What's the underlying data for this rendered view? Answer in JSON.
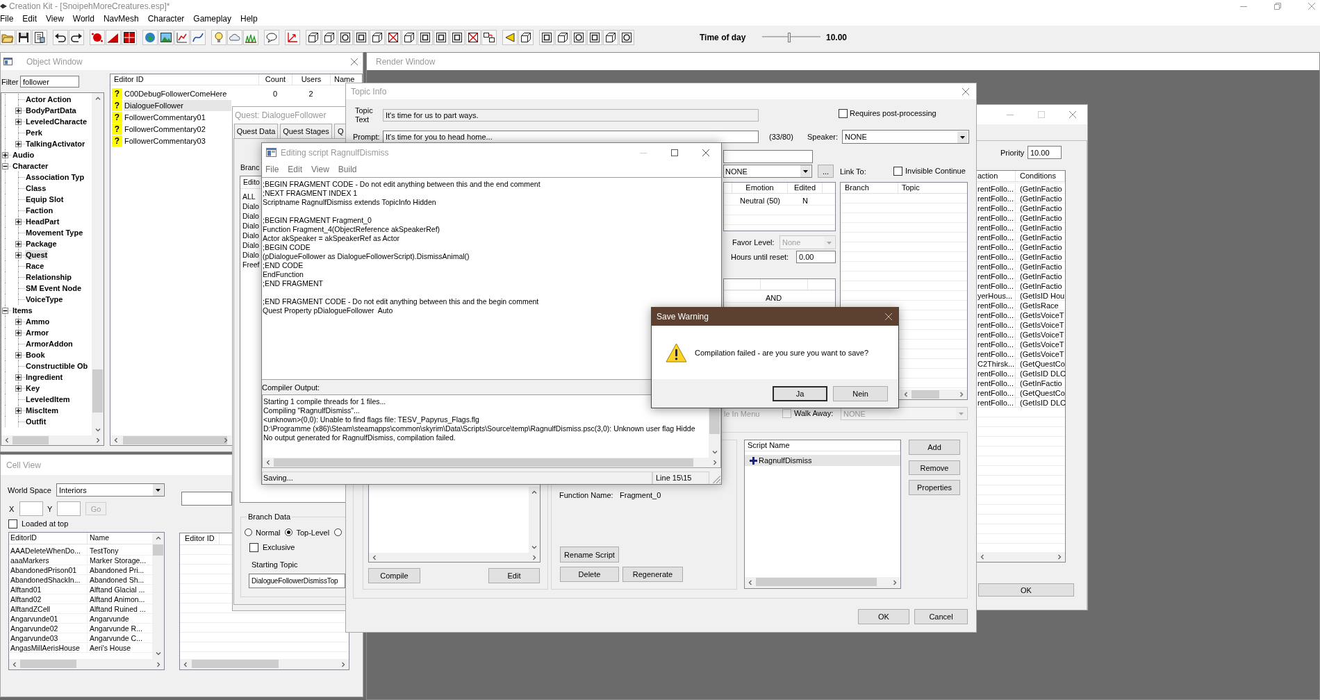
{
  "app": {
    "title": "Creation Kit - [SnoipehMoreCreatures.esp]*"
  },
  "menu": [
    "File",
    "Edit",
    "View",
    "World",
    "NavMesh",
    "Character",
    "Gameplay",
    "Help"
  ],
  "toolbar": {
    "time_label": "Time of day",
    "time_slider": {
      "level": 0.46
    },
    "time_value": "10.00"
  },
  "object_window": {
    "title": "Object Window",
    "filter_label": "Filter",
    "filter_value": "follower",
    "tree": {
      "scrolled_parent_children": [
        {
          "label": "Actor Action",
          "expandable": false,
          "selected": false
        },
        {
          "label": "BodyPartData",
          "expandable": true,
          "expanded": false,
          "selected": false
        },
        {
          "label": "LeveledCharacte",
          "expandable": true,
          "expanded": false,
          "selected": false
        },
        {
          "label": "Perk",
          "expandable": false,
          "selected": false
        },
        {
          "label": "TalkingActivator",
          "expandable": true,
          "expanded": false,
          "selected": false
        }
      ],
      "items": [
        {
          "label": "Audio",
          "expandable": true,
          "expanded": false,
          "selected": false
        },
        {
          "label": "Character",
          "expandable": true,
          "expanded": true,
          "selected": false,
          "children": [
            {
              "label": "Association Typ",
              "expandable": false,
              "selected": false
            },
            {
              "label": "Class",
              "expandable": false,
              "selected": false
            },
            {
              "label": "Equip Slot",
              "expandable": false,
              "selected": false
            },
            {
              "label": "Faction",
              "expandable": false,
              "selected": false
            },
            {
              "label": "HeadPart",
              "expandable": true,
              "expanded": false,
              "selected": false
            },
            {
              "label": "Movement Type",
              "expandable": false,
              "selected": false
            },
            {
              "label": "Package",
              "expandable": true,
              "expanded": false,
              "selected": false
            },
            {
              "label": "Quest",
              "expandable": true,
              "expanded": false,
              "selected": true
            },
            {
              "label": "Race",
              "expandable": false,
              "selected": false
            },
            {
              "label": "Relationship",
              "expandable": false,
              "selected": false
            },
            {
              "label": "SM Event Node",
              "expandable": false,
              "selected": false
            },
            {
              "label": "VoiceType",
              "expandable": false,
              "selected": false
            }
          ]
        },
        {
          "label": "Items",
          "expandable": true,
          "expanded": true,
          "selected": false,
          "children": [
            {
              "label": "Ammo",
              "expandable": true,
              "expanded": false,
              "selected": false
            },
            {
              "label": "Armor",
              "expandable": true,
              "expanded": false,
              "selected": false
            },
            {
              "label": "ArmorAddon",
              "expandable": false,
              "selected": false
            },
            {
              "label": "Book",
              "expandable": true,
              "expanded": false,
              "selected": false
            },
            {
              "label": "Constructible Ob",
              "expandable": false,
              "selected": false
            },
            {
              "label": "Ingredient",
              "expandable": true,
              "expanded": false,
              "selected": false
            },
            {
              "label": "Key",
              "expandable": true,
              "expanded": false,
              "selected": false
            },
            {
              "label": "LeveledItem",
              "expandable": false,
              "selected": false
            },
            {
              "label": "MiscItem",
              "expandable": true,
              "expanded": false,
              "selected": false
            },
            {
              "label": "Outfit",
              "expandable": false,
              "selected": false
            }
          ]
        }
      ]
    },
    "list": {
      "columns": [
        "Editor ID",
        "Count",
        "Users",
        "Name"
      ],
      "rows": [
        {
          "marker": "?",
          "editor_id": "C00DebugFollowerComeHere",
          "count": "0",
          "users": "2",
          "selected": false
        },
        {
          "marker": "?",
          "editor_id": "DialogueFollower",
          "selected": true
        },
        {
          "marker": "?",
          "editor_id": "FollowerCommentary01",
          "selected": false
        },
        {
          "marker": "?",
          "editor_id": "FollowerCommentary02",
          "selected": false
        },
        {
          "marker": "?",
          "editor_id": "FollowerCommentary03",
          "selected": false
        }
      ]
    }
  },
  "render_window": {
    "title": "Render Window"
  },
  "cell_view": {
    "title": "Cell View",
    "world_space": {
      "label": "World Space",
      "value": "Interiors"
    },
    "x_label": "X",
    "y_label": "Y",
    "go_button": {
      "label": "Go",
      "disabled": true
    },
    "loaded_at_top": {
      "label": "Loaded at top",
      "checked": false
    },
    "cell_list": {
      "columns": [
        "EditorID",
        "Name"
      ],
      "rows": [
        {
          "editor_id": "AAADeleteWhenDo...",
          "name": "TestTony"
        },
        {
          "editor_id": "aaaMarkers",
          "name": "Marker Storage..."
        },
        {
          "editor_id": "AbandonedPrison01",
          "name": "Abandoned Pri..."
        },
        {
          "editor_id": "AbandonedShackIn...",
          "name": "Abandoned Sh..."
        },
        {
          "editor_id": "Alftand01",
          "name": "Alftand Glacial ..."
        },
        {
          "editor_id": "Alftand02",
          "name": "Alftand Animon..."
        },
        {
          "editor_id": "AlftandZCell",
          "name": "Alftand Ruined ..."
        },
        {
          "editor_id": "Angarvunde01",
          "name": "Angarvunde"
        },
        {
          "editor_id": "Angarvunde02",
          "name": "Angarvunde R..."
        },
        {
          "editor_id": "Angarvunde03",
          "name": "Angarvunde C..."
        },
        {
          "editor_id": "AngasMillAerisHouse",
          "name": "Aeri's House"
        }
      ]
    },
    "reference_list": {
      "columns": [
        "Editor ID"
      ]
    }
  },
  "quest_window": {
    "title": "Quest: DialogueFollower",
    "tabs": [
      {
        "label": "Quest Data",
        "selected": false
      },
      {
        "label": "Quest Stages",
        "selected": false
      },
      {
        "label": "Q",
        "selected": false
      }
    ],
    "branch_label": "Branc",
    "branch_list": {
      "columns": [
        "Edito"
      ],
      "rows": [
        "ALL",
        "Dialo",
        "Dialo",
        "Dialo",
        "Dialo",
        "Dialo",
        "Dialo",
        "Freef"
      ]
    },
    "branch_data": {
      "title": "Branch Data",
      "types": [
        {
          "label": "Normal",
          "selected": false
        },
        {
          "label": "Top-Level",
          "selected": true
        },
        {
          "selected": false
        }
      ],
      "exclusive": {
        "label": "Exclusive",
        "checked": false
      },
      "starting_topic_label": "Starting Topic",
      "starting_topic_value": "DialogueFollowerDismissTop"
    }
  },
  "topic_info": {
    "title": "Topic Info",
    "topic_text": {
      "label": "Topic Text",
      "value": "It's time for us to part ways.",
      "read_only": true
    },
    "requires_post_processing": {
      "label": "Requires post-processing",
      "checked": false
    },
    "prompt": {
      "label": "Prompt:",
      "value": "It's time for you to head home...",
      "count": "(33/80)"
    },
    "speaker": {
      "label": "Speaker:",
      "value": "NONE"
    },
    "unlabeled_dropdown": {
      "value": "NONE"
    },
    "browse_button": "...",
    "link_to_label": "Link To:",
    "invisible_continue": {
      "label": "Invisible Continue",
      "checked": false
    },
    "responses": {
      "columns": [
        "Emotion",
        "Edited"
      ],
      "rows": [
        {
          "emotion": "Neutral (50)",
          "edited": "N"
        }
      ]
    },
    "favor_level": {
      "label": "Favor Level:",
      "value": "None",
      "disabled": true
    },
    "hours_until_reset": {
      "label": "Hours until reset:",
      "value": "0.00"
    },
    "conditions": {
      "rows": [
        "AND"
      ]
    },
    "links": {
      "columns": [
        "Branch",
        "Topic"
      ]
    },
    "partial_label": {
      "label": "le In Menu",
      "disabled": true
    },
    "walk_away": {
      "label": "Walk Away:",
      "checked": false,
      "value": "NONE",
      "disabled": true
    },
    "fragment_buttons": [
      "Compile",
      "Edit"
    ],
    "function_name": {
      "label": "Function Name:",
      "value": "Fragment_0"
    },
    "rename_button": "Rename Script",
    "fragment_actions": [
      "Delete",
      "Regenerate"
    ],
    "scripts": {
      "columns": [
        "Script Name"
      ],
      "rows": [
        {
          "name": "RagnulfDismiss",
          "selected": true
        }
      ]
    },
    "script_buttons": [
      "Add",
      "Remove",
      "Properties"
    ],
    "buttons": [
      "OK",
      "Cancel"
    ]
  },
  "background_dialog": {
    "priority": {
      "label": "Priority",
      "value": "10.00"
    },
    "columns": [
      "action",
      "Conditions"
    ],
    "rows": [
      {
        "column_1": "rentFollo...",
        "conditions": "(GetInFactio"
      },
      {
        "column_1": "rentFollo...",
        "conditions": "(GetInFactio"
      },
      {
        "column_1": "rentFollo...",
        "conditions": "(GetInFactio"
      },
      {
        "column_1": "rentFollo...",
        "conditions": "(GetInFactio"
      },
      {
        "column_1": "rentFollo...",
        "conditions": "(GetInFactio"
      },
      {
        "column_1": "rentFollo...",
        "conditions": "(GetInFactio"
      },
      {
        "column_1": "rentFollo...",
        "conditions": "(GetInFactio"
      },
      {
        "column_1": "rentFollo...",
        "conditions": "(GetInFactio"
      },
      {
        "column_1": "rentFollo...",
        "conditions": "(GetInFactio"
      },
      {
        "column_1": "rentFollo...",
        "conditions": "(GetInFactio"
      },
      {
        "column_1": "rentFollo...",
        "conditions": "(GetInFactio"
      },
      {
        "column_1": "yerHous...",
        "conditions": "(GetIsID Hou"
      },
      {
        "column_1": "rentFollo...",
        "conditions": "(GetIsRace"
      },
      {
        "column_1": "rentFollo...",
        "conditions": "(GetIsVoiceT"
      },
      {
        "column_1": "rentFollo...",
        "conditions": "(GetIsVoiceT"
      },
      {
        "column_1": "rentFollo...",
        "conditions": "(GetIsVoiceT"
      },
      {
        "column_1": "rentFollo...",
        "conditions": "(GetIsVoiceT"
      },
      {
        "column_1": "rentFollo...",
        "conditions": "(GetIsVoiceT"
      },
      {
        "column_1": "C2Thirsk...",
        "conditions": "(GetQuestCo"
      },
      {
        "column_1": "rentFollo...",
        "conditions": "(GetIsID DLC"
      },
      {
        "column_1": "rentFollo...",
        "conditions": "(GetInFactio"
      },
      {
        "column_1": "rentFollo...",
        "conditions": "(GetQuestCo"
      },
      {
        "column_1": "rentFollo...",
        "conditions": "(GetIsID DLC"
      }
    ],
    "ok_button": "OK"
  },
  "script_editor": {
    "title": "Editing script RagnulfDismiss",
    "menu": [
      "File",
      "Edit",
      "View",
      "Build"
    ],
    "code": ";BEGIN FRAGMENT CODE - Do not edit anything between this and the end comment\n;NEXT FRAGMENT INDEX 1\nScriptname RagnulfDismiss extends TopicInfo Hidden\n\n;BEGIN FRAGMENT Fragment_0\nFunction Fragment_4(ObjectReference akSpeakerRef)\nActor akSpeaker = akSpeakerRef as Actor\n;BEGIN CODE\n(pDialogueFollower as DialogueFollowerScript).DismissAnimal()\n;END CODE\nEndFunction\n;END FRAGMENT\n\n;END FRAGMENT CODE - Do not edit anything between this and the begin comment\nQuest Property pDialogueFollower  Auto",
    "output_label": "Compiler Output:",
    "output": "Starting 1 compile threads for 1 files...\nCompiling \"RagnulfDismiss\"...\n<unknown>(0,0): Unable to find flags file: TESV_Papyrus_Flags.flg\nD:\\Programme (x86)\\Steam\\steamapps\\common\\skyrim\\Data\\Scripts\\Source\\temp\\RagnulfDismiss.psc(3,0): Unknown user flag Hidde\nNo output generated for RagnulfDismiss, compilation failed.",
    "status": "Saving...",
    "position": "Line 15\\15"
  },
  "save_warning": {
    "title": "Save Warning",
    "message": "Compilation failed - are you sure you want to save?",
    "buttons": [
      {
        "label": "Ja",
        "default": true
      },
      {
        "label": "Nein",
        "default": false
      }
    ]
  }
}
